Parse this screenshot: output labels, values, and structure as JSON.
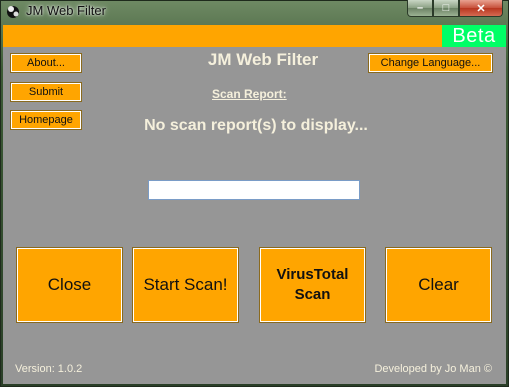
{
  "window": {
    "title": "JM Web Filter",
    "controls": {
      "minimize": "–",
      "maximize": "□",
      "close": "✕"
    }
  },
  "header": {
    "badge": "Beta"
  },
  "left_buttons": [
    {
      "label": "About..."
    },
    {
      "label": "Submit"
    },
    {
      "label": "Homepage"
    }
  ],
  "change_language_label": "Change Language...",
  "main": {
    "title": "JM Web Filter",
    "scan_report_label": "Scan Report:",
    "empty_message": "No scan report(s) to display...",
    "url_input": {
      "value": "",
      "placeholder": ""
    }
  },
  "actions": {
    "close": "Close",
    "start_scan": "Start Scan!",
    "virustotal_line1": "VirusTotal",
    "virustotal_line2": "Scan",
    "clear": "Clear"
  },
  "footer": {
    "version": "Version: 1.0.2",
    "developer": "Developed by Jo Man ©"
  },
  "colors": {
    "accent": "#ffa500",
    "beta": "#00ff66",
    "background": "#969696",
    "light_text": "#f5f0dc"
  }
}
